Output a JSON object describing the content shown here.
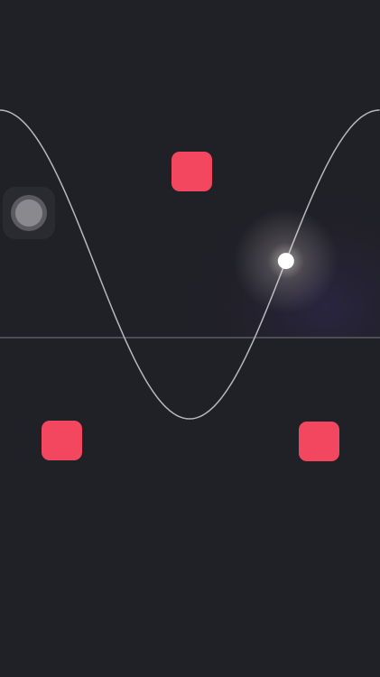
{
  "colors": {
    "background": "#202027",
    "night_glow": "#2a2540",
    "curve": "#b8b8bc",
    "horizon": "#5c5c66",
    "obstacle": "#f2475f",
    "ball": "#ffffff",
    "ball_glow": "#fff6e6"
  },
  "game": {
    "ball_progress": 0.83,
    "obstacles": [
      {
        "icon": "rounded-square"
      },
      {
        "icon": "rounded-square"
      },
      {
        "icon": "rounded-square"
      }
    ]
  },
  "assistive_touch": {
    "icon": "assistive-touch-icon"
  }
}
